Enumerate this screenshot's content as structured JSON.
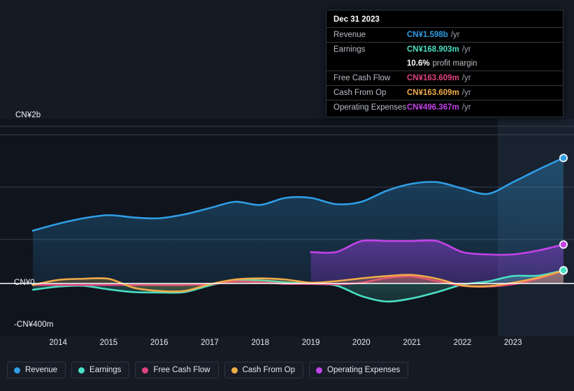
{
  "tooltip": {
    "date": "Dec 31 2023",
    "rows": [
      {
        "label": "Revenue",
        "value": "CN¥1.598b",
        "unit": "/yr",
        "color": "#2f9ee5"
      },
      {
        "label": "Earnings",
        "value": "CN¥168.903m",
        "unit": "/yr",
        "color": "#4adfc4"
      },
      {
        "label": "Free Cash Flow",
        "value": "CN¥163.609m",
        "unit": "/yr",
        "color": "#e0427d"
      },
      {
        "label": "Cash From Op",
        "value": "CN¥163.609m",
        "unit": "/yr",
        "color": "#efab49"
      },
      {
        "label": "Operating Expenses",
        "value": "CN¥496.367m",
        "unit": "/yr",
        "color": "#c342e8"
      }
    ],
    "profit_margin_value": "10.6%",
    "profit_margin_text": "profit margin"
  },
  "legend": [
    {
      "label": "Revenue",
      "color": "#2f9ee5"
    },
    {
      "label": "Earnings",
      "color": "#4adfc4"
    },
    {
      "label": "Free Cash Flow",
      "color": "#e0427d"
    },
    {
      "label": "Cash From Op",
      "color": "#efab49"
    },
    {
      "label": "Operating Expenses",
      "color": "#c342e8"
    }
  ],
  "axis": {
    "y_top_label": "CN¥2b",
    "y_zero_label": "CN¥0",
    "y_bottom_label": "-CN¥400m",
    "x_labels": [
      "2014",
      "2015",
      "2016",
      "2017",
      "2018",
      "2019",
      "2020",
      "2021",
      "2022",
      "2023"
    ]
  },
  "chart_data": {
    "type": "area",
    "title": "",
    "xlabel": "",
    "ylabel": "CN¥",
    "ylim": [
      -400,
      2000
    ],
    "y_unit": "millions CN¥",
    "yticks": [
      2000,
      0,
      -400
    ],
    "grid": true,
    "legend_position": "bottom",
    "x": [
      2013.5,
      2014.0,
      2014.5,
      2015.0,
      2015.5,
      2016.0,
      2016.5,
      2017.0,
      2017.5,
      2018.0,
      2018.5,
      2019.0,
      2019.5,
      2020.0,
      2020.5,
      2021.0,
      2021.5,
      2022.0,
      2022.5,
      2023.0,
      2023.5,
      2024.0
    ],
    "x_tick_positions": [
      2014,
      2015,
      2016,
      2017,
      2018,
      2019,
      2020,
      2021,
      2022,
      2023
    ],
    "forecast_start": 2022.7,
    "series": [
      {
        "name": "Revenue",
        "color": "#2f9ee5",
        "values": [
          672,
          760,
          830,
          870,
          840,
          830,
          880,
          960,
          1040,
          1000,
          1090,
          1090,
          1010,
          1040,
          1180,
          1270,
          1290,
          1210,
          1140,
          1290,
          1450,
          1598
        ]
      },
      {
        "name": "Earnings",
        "color": "#4adfc4",
        "values": [
          -80,
          -40,
          -30,
          -75,
          -110,
          -115,
          -110,
          -25,
          40,
          40,
          15,
          -5,
          -25,
          -160,
          -230,
          -190,
          -110,
          -15,
          25,
          95,
          100,
          169
        ]
      },
      {
        "name": "Free Cash Flow",
        "color": "#e0427d",
        "values": [
          -20,
          -20,
          -20,
          -20,
          -20,
          -20,
          -20,
          -10,
          25,
          15,
          -5,
          -5,
          -10,
          10,
          70,
          90,
          30,
          -30,
          -40,
          -10,
          60,
          164
        ]
      },
      {
        "name": "Cash From Op",
        "color": "#efab49",
        "values": [
          -20,
          45,
          60,
          60,
          -55,
          -95,
          -95,
          -10,
          50,
          65,
          50,
          10,
          30,
          65,
          95,
          110,
          60,
          -25,
          -35,
          10,
          75,
          164
        ]
      },
      {
        "name": "Operating Expenses",
        "color": "#c342e8",
        "values": [
          null,
          null,
          null,
          null,
          null,
          null,
          null,
          null,
          null,
          null,
          null,
          400,
          400,
          540,
          540,
          540,
          540,
          400,
          370,
          370,
          420,
          496
        ]
      }
    ]
  }
}
